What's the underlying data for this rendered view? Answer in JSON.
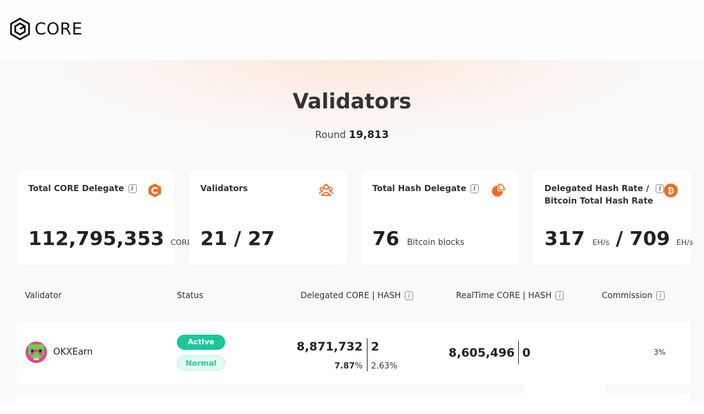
{
  "brand": {
    "name": "CORE",
    "logo_icon": "core-hexagon-logo"
  },
  "page": {
    "title": "Validators",
    "round_label": "Round",
    "round_value": "19,813"
  },
  "cards": [
    {
      "label": "Total CORE Delegate",
      "has_info": true,
      "icon": "core-c-icon",
      "value": "112,795,353",
      "unit": "CORE"
    },
    {
      "label": "Validators",
      "has_info": false,
      "icon": "users-icon",
      "value": "21 / 27"
    },
    {
      "label": "Total Hash Delegate",
      "has_info": true,
      "icon": "pie-chart-icon",
      "value": "76",
      "unit": "Bitcoin blocks"
    },
    {
      "label_line1": "Delegated Hash Rate /",
      "label_line2": "Bitcoin Total Hash Rate",
      "has_info": true,
      "icon": "bitcoin-icon",
      "value1": "317",
      "unit1": "EH/s",
      "value2": "/ 709",
      "unit2": "EH/s"
    }
  ],
  "table": {
    "headers": {
      "validator": "Validator",
      "status": "Status",
      "delegated": "Delegated CORE | HASH",
      "realtime": "RealTime CORE | HASH",
      "commission": "Commission"
    },
    "rows": [
      {
        "name": "OKXEarn",
        "status": "Active",
        "sub_status": "Normal",
        "delegated_core": "8,871,732",
        "delegated_hash": "2",
        "delegated_core_pct": "7.87",
        "pct_symbol": "%",
        "delegated_hash_pct": "2.63%",
        "realtime_core": "8,605,496",
        "realtime_hash": "0",
        "commission": "3%"
      }
    ]
  },
  "colors": {
    "accent": "#f26a22",
    "active": "#19c79a",
    "normal_bg": "#e3faf2"
  }
}
